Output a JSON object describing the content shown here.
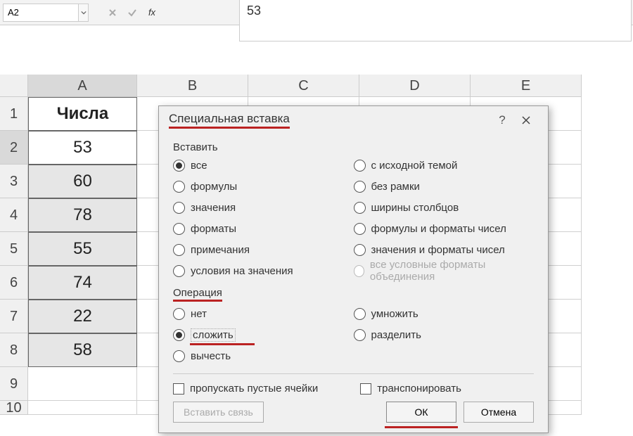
{
  "fbar": {
    "namebox": "A2",
    "fx": "fx",
    "formula_value": "53"
  },
  "columns": [
    "A",
    "B",
    "C",
    "D",
    "E"
  ],
  "rows": [
    {
      "n": "1",
      "A": "Числа"
    },
    {
      "n": "2",
      "A": "53"
    },
    {
      "n": "3",
      "A": "60"
    },
    {
      "n": "4",
      "A": "78"
    },
    {
      "n": "5",
      "A": "55"
    },
    {
      "n": "6",
      "A": "74"
    },
    {
      "n": "7",
      "A": "22"
    },
    {
      "n": "8",
      "A": "58"
    },
    {
      "n": "9",
      "A": ""
    },
    {
      "n": "10",
      "A": ""
    }
  ],
  "dialog": {
    "title": "Специальная вставка",
    "help": "?",
    "paste_label": "Вставить",
    "paste_left": [
      "все",
      "формулы",
      "значения",
      "форматы",
      "примечания",
      "условия на значения"
    ],
    "paste_right": [
      "с исходной темой",
      "без рамки",
      "ширины столбцов",
      "формулы и форматы чисел",
      "значения и форматы чисел",
      "все условные форматы объединения"
    ],
    "op_label": "Операция",
    "op_left": [
      "нет",
      "сложить",
      "вычесть"
    ],
    "op_right": [
      "умножить",
      "разделить"
    ],
    "skip_blanks": "пропускать пустые ячейки",
    "transpose": "транспонировать",
    "paste_link": "Вставить связь",
    "ok": "ОК",
    "cancel": "Отмена"
  }
}
